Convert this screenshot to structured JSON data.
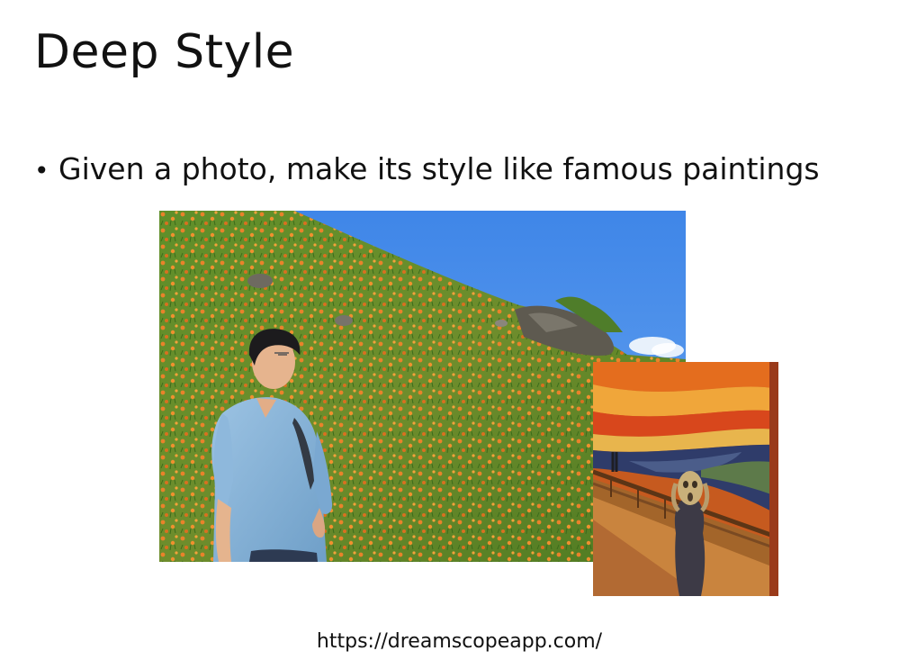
{
  "slide": {
    "title": "Deep Style",
    "bullets": [
      {
        "marker": "•",
        "text": "Given a photo, make its style like famous paintings"
      }
    ],
    "source_url": "https://dreamscopeapp.com/"
  },
  "images": {
    "content_photo": {
      "subject": "man on hillside of orange lily flowers under blue sky"
    },
    "style_painting": {
      "subject": "The Scream painting"
    }
  }
}
